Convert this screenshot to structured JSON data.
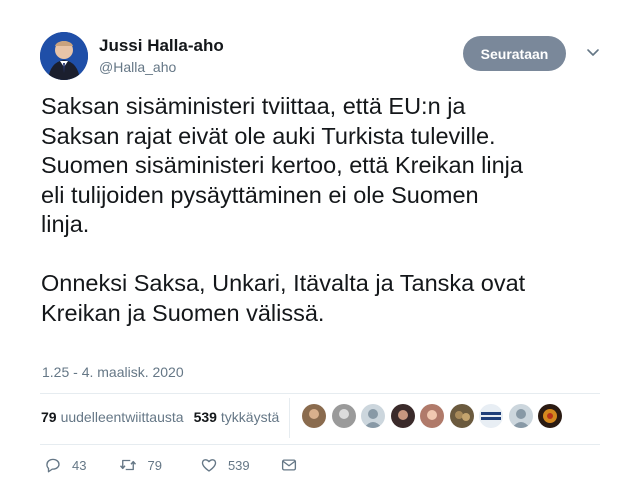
{
  "author": {
    "name": "Jussi Halla-aho",
    "handle": "@Halla_aho",
    "follow_label": "Seurataan"
  },
  "tweet": {
    "text": "Saksan sisäministeri tviittaa, että EU:n ja\nSaksan rajat eivät ole auki Turkista tuleville.\nSuomen sisäministeri kertoo, että Kreikan linja\neli tulijoiden pysäyttäminen ei ole Suomen\nlinja.\n\nOnneksi Saksa, Unkari, Itävalta ja Tanska ovat\nKreikan ja Suomen välissä.",
    "timestamp": "1.25 - 4. maalisk. 2020"
  },
  "stats": {
    "retweets_count": "79",
    "retweets_label": "uudelleentwiittausta",
    "likes_count": "539",
    "likes_label": "tykkäystä"
  },
  "actions": {
    "replies": "43",
    "retweets": "79",
    "likes": "539"
  },
  "icons": {
    "reply": "reply-icon",
    "retweet": "retweet-icon",
    "like": "heart-icon",
    "dm": "envelope-icon",
    "menu": "chevron-down-icon"
  },
  "colors": {
    "follow_button": "#7a889a",
    "muted_text": "#657786",
    "text": "#14171a"
  }
}
